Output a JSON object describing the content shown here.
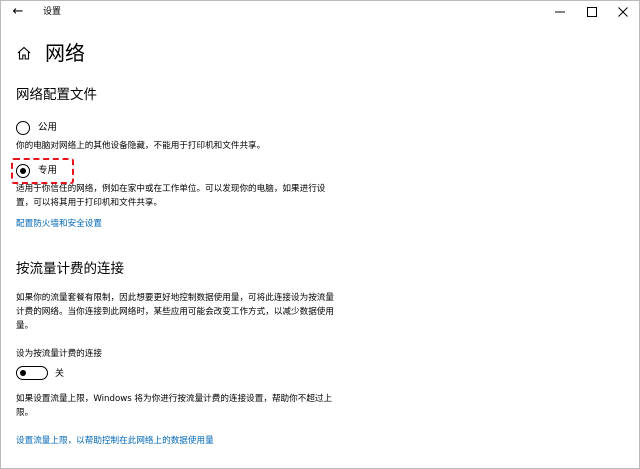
{
  "window": {
    "title": "设置",
    "back_glyph": "←",
    "controls": [
      "minimize-icon",
      "maximize-icon",
      "close-icon"
    ]
  },
  "page": {
    "title": "网络",
    "home_icon": "home-icon"
  },
  "profile": {
    "section_title": "网络配置文件",
    "options": [
      {
        "label": "公用",
        "selected": false,
        "description": "你的电脑对网络上的其他设备隐藏，不能用于打印机和文件共享。"
      },
      {
        "label": "专用",
        "selected": true,
        "description": "适用于你信任的网络，例如在家中或在工作单位。可以发现你的电脑，如果进行设置，可以将其用于打印机和文件共享。"
      }
    ],
    "firewall_link": "配置防火墙和安全设置"
  },
  "metered": {
    "section_title": "按流量计费的连接",
    "description": "如果你的流量套餐有限制，因此想要更好地控制数据使用量，可将此连接设为按流量计费的网络。当你连接到此网络时，某些应用可能会改变工作方式，以减少数据使用量。",
    "toggle_label": "设为按流量计费的连接",
    "toggle_on": false,
    "toggle_state": "关",
    "limit_note": "如果设置流量上限，Windows 将为你进行按流量计费的连接设置，帮助你不超过上限。",
    "limit_link": "设置流量上限，以帮助控制在此网络上的数据使用量"
  },
  "colors": {
    "link": "#0067b8",
    "highlight": "#e8141c",
    "background": "#ffffff"
  }
}
